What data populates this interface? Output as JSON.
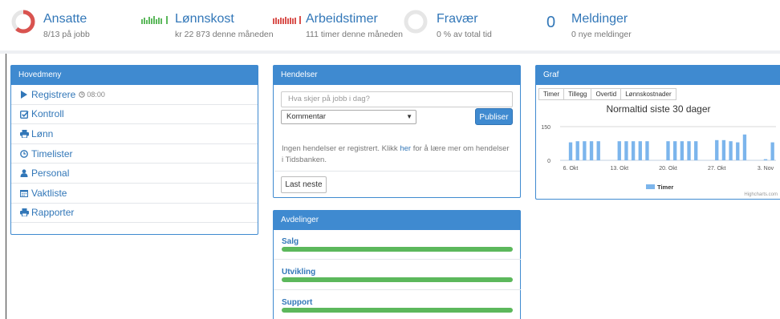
{
  "stats": {
    "ansatte": {
      "title": "Ansatte",
      "sub": "8/13 på jobb",
      "fraction": 0.615,
      "color": "#d9534f"
    },
    "lonnskost": {
      "title": "Lønnskost",
      "sub": "kr 22 873 denne måneden",
      "color": "#5cb85c"
    },
    "arbeidstimer": {
      "title": "Arbeidstimer",
      "sub": "111  timer denne måneden",
      "color": "#d9534f"
    },
    "fravaer": {
      "title": "Fravær",
      "sub": "0 % av total tid",
      "fraction": 0
    },
    "meldinger": {
      "count": "0",
      "title": "Meldinger",
      "sub": "0 nye meldinger"
    }
  },
  "menu": {
    "header": "Hovedmeny",
    "items": [
      {
        "label": "Registrere",
        "time": "08:00",
        "icon": "play-icon"
      },
      {
        "label": "Kontroll",
        "icon": "checkbox-icon"
      },
      {
        "label": "Lønn",
        "icon": "print-icon"
      },
      {
        "label": "Timelister",
        "icon": "clock-icon"
      },
      {
        "label": "Personal",
        "icon": "user-icon"
      },
      {
        "label": "Vaktliste",
        "icon": "calendar-icon"
      },
      {
        "label": "Rapporter",
        "icon": "print-icon"
      }
    ]
  },
  "events": {
    "header": "Hendelser",
    "placeholder": "Hva skjer på jobb i dag?",
    "select_value": "Kommentar",
    "publish": "Publiser",
    "info_before": "Ingen hendelser er registrert. Klikk",
    "info_link": "her",
    "info_after": "for å lære mer om hendelser i Tidsbanken.",
    "load_more": "Last neste"
  },
  "departments": {
    "header": "Avdelinger",
    "items": [
      {
        "name": "Salg",
        "fraction": 1.0
      },
      {
        "name": "Utvikling",
        "fraction": 1.0
      },
      {
        "name": "Support",
        "fraction": 1.0
      }
    ]
  },
  "graph": {
    "header": "Graf",
    "tabs": [
      "Timer",
      "Tillegg",
      "Overtid",
      "Lønnskostnader"
    ],
    "credit": "Highcharts.com"
  },
  "chart_data": {
    "type": "bar",
    "title": "Normaltid siste 30 dager",
    "y_ticks": [
      "150",
      "0"
    ],
    "ylim": [
      0,
      150
    ],
    "x_ticks": [
      "6. Okt",
      "13. Okt",
      "20. Okt",
      "27. Okt",
      "3. Nov"
    ],
    "series": [
      {
        "name": "Timer",
        "color": "#7cb5ec",
        "values": [
          0,
          80,
          85,
          85,
          85,
          85,
          0,
          0,
          85,
          85,
          85,
          85,
          85,
          0,
          0,
          85,
          85,
          85,
          85,
          85,
          0,
          0,
          90,
          90,
          85,
          80,
          115,
          0,
          0,
          5,
          80
        ]
      }
    ]
  },
  "colors": {
    "accent": "#3f8ad0",
    "link": "#3277b8",
    "green": "#5cb85c",
    "red": "#d9534f",
    "bar": "#7cb5ec"
  }
}
